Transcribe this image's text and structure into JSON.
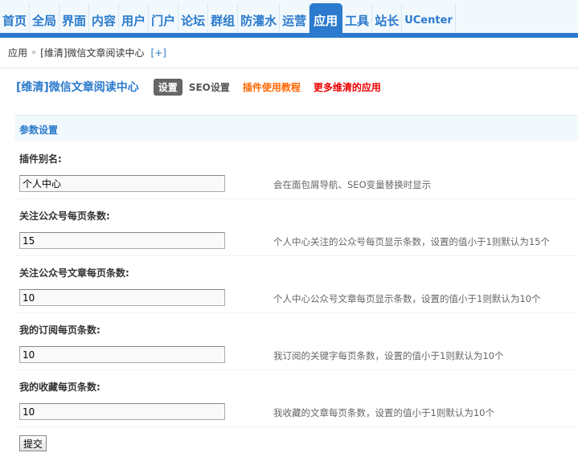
{
  "nav": {
    "tabs": [
      {
        "label": "首页"
      },
      {
        "label": "全局"
      },
      {
        "label": "界面"
      },
      {
        "label": "内容"
      },
      {
        "label": "用户"
      },
      {
        "label": "门户"
      },
      {
        "label": "论坛"
      },
      {
        "label": "群组"
      },
      {
        "label": "防灌水"
      },
      {
        "label": "运营"
      },
      {
        "label": "应用"
      },
      {
        "label": "工具"
      },
      {
        "label": "站长"
      },
      {
        "label": "UCenter"
      }
    ],
    "active_index": 10
  },
  "breadcrumb": {
    "root": "应用",
    "separator": "»",
    "current": "[维清]微信文章阅读中心",
    "add_label": "[+]"
  },
  "plugin": {
    "title": "[维清]微信文章阅读中心",
    "settings_label": "设置",
    "seo_label": "SEO设置",
    "tutorial_label": "插件使用教程",
    "more_label": "更多维清的应用"
  },
  "section": {
    "title": "参数设置"
  },
  "fields": [
    {
      "label": "插件别名:",
      "value": "个人中心",
      "tip": "会在面包屑导航、SEO变量替换时显示"
    },
    {
      "label": "关注公众号每页条数:",
      "value": "15",
      "tip": "个人中心关注的公众号每页显示条数，设置的值小于1则默认为15个"
    },
    {
      "label": "关注公众号文章每页条数:",
      "value": "10",
      "tip": "个人中心公众号文章每页显示条数，设置的值小于1则默认为10个"
    },
    {
      "label": "我的订阅每页条数:",
      "value": "10",
      "tip": "我订阅的关键字每页条数，设置的值小于1则默认为10个"
    },
    {
      "label": "我的收藏每页条数:",
      "value": "10",
      "tip": "我收藏的文章每页条数，设置的值小于1则默认为10个"
    }
  ],
  "submit_label": "提交",
  "colors": {
    "accent": "#2b7acd",
    "tutorial": "#ff6600",
    "more": "#ee0000"
  }
}
